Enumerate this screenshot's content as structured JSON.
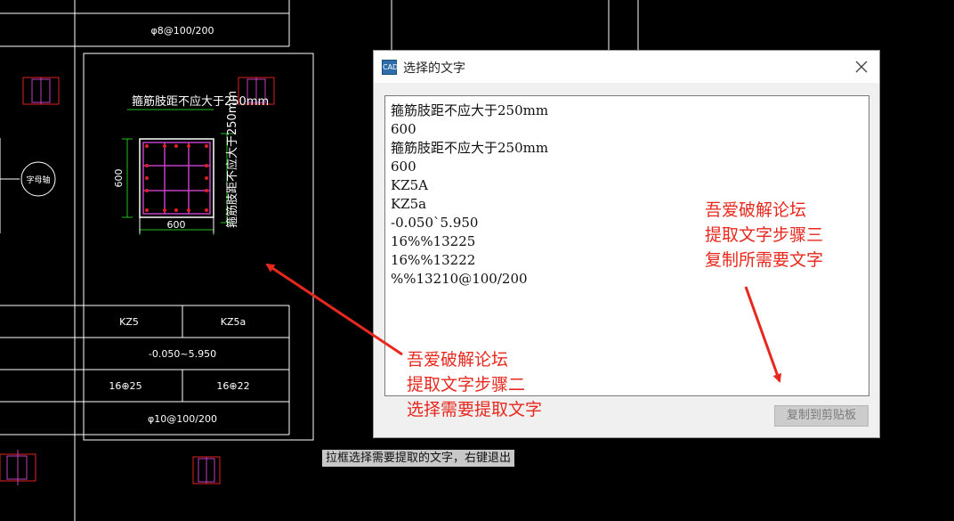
{
  "drawing": {
    "top_rebar": "φ8@100/200",
    "note_horizontal": "箍筋肢距不应大于250mm",
    "note_vertical": "箍筋肢距不应大于250mm",
    "dim_width": "600",
    "dim_height": "600",
    "circle_label": "字母轴",
    "table": {
      "col_name_1": "KZ5",
      "col_name_2": "KZ5a",
      "elevation": "-0.050~5.950",
      "bars_1": "16⊕25",
      "bars_2": "16⊕22",
      "stirrup": "φ10@100/200"
    }
  },
  "dialog": {
    "title": "选择的文字",
    "icon_text": "CAD",
    "lines": [
      "箍筋肢距不应大于250mm",
      "600",
      "箍筋肢距不应大于250mm",
      "600",
      "KZ5A",
      "KZ5a",
      "-0.050`5.950",
      "16%%13225",
      "16%%13222",
      "%%13210@100/200"
    ],
    "copy_button": "复制到剪贴板"
  },
  "annotation_step2": [
    "吾爱破解论坛",
    "提取文字步骤二",
    "选择需要提取文字"
  ],
  "annotation_step3": [
    "吾爱破解论坛",
    "提取文字步骤三",
    "复制所需要文字"
  ],
  "command_hint": "拉框选择需要提取的文字，右键退出",
  "colors": {
    "annotation": "#e8281e",
    "cad_white": "#ffffff",
    "cad_magenta": "#c040c0",
    "cad_red": "#e02020",
    "cad_green": "#20c020"
  }
}
